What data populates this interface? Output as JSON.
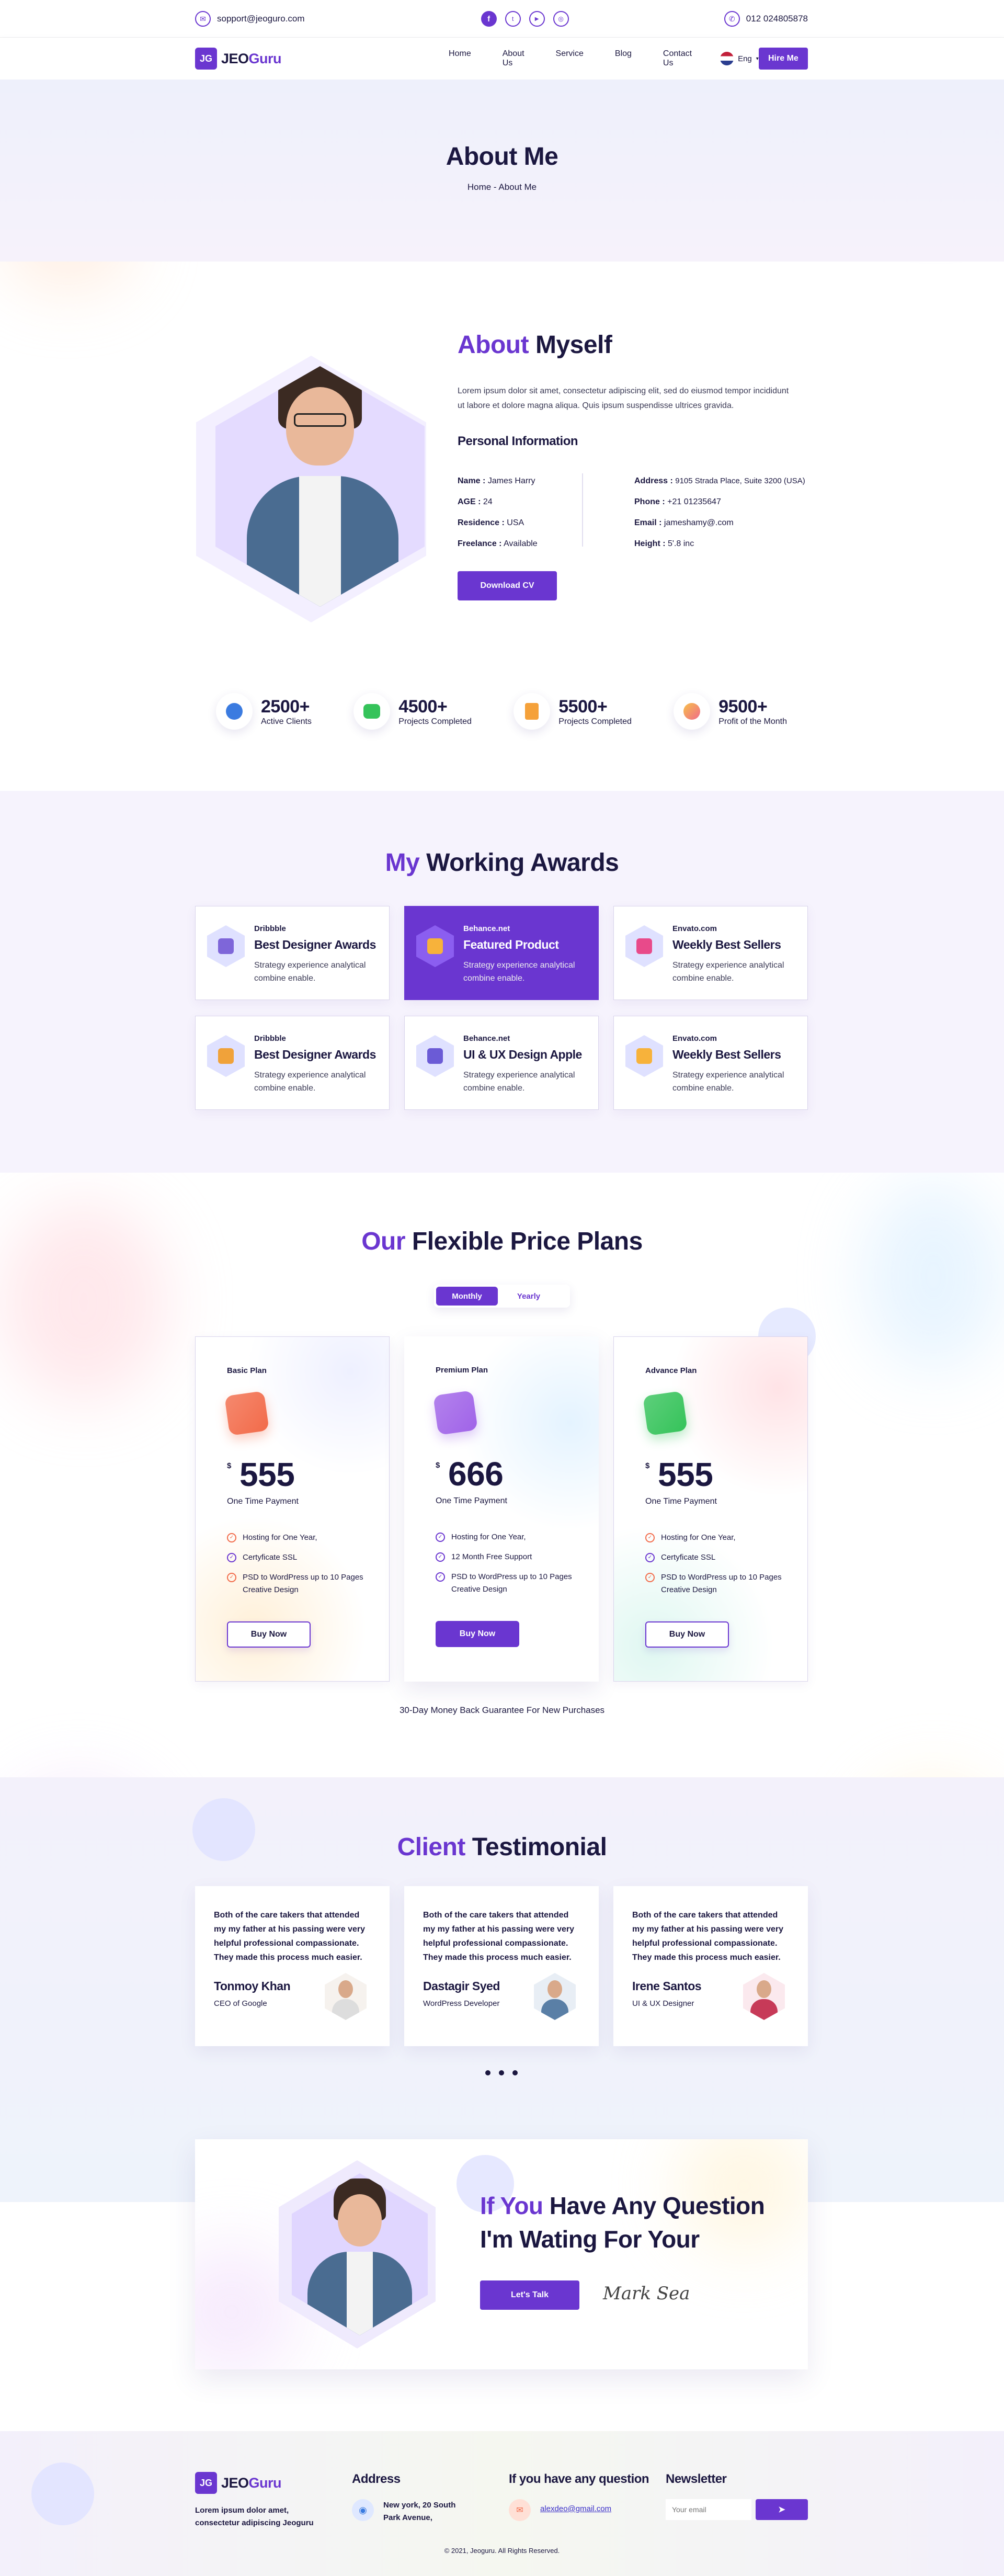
{
  "topbar": {
    "email": "sopport@jeoguro.com",
    "phone": "012 024805878",
    "socials": [
      "facebook-icon",
      "twitter-icon",
      "youtube-icon",
      "instagram-icon"
    ]
  },
  "nav": {
    "logo_mark": "JG",
    "logo_a": "JEO",
    "logo_b": "Guru",
    "links": [
      "Home",
      "About Us",
      "Service",
      "Blog",
      "Contact Us"
    ],
    "lang": "Eng",
    "hire": "Hire Me"
  },
  "hero": {
    "title": "About Me",
    "crumb": "Home - About Me"
  },
  "about": {
    "title_a": "About",
    "title_b": "Myself",
    "desc": "Lorem ipsum dolor sit amet, consectetur adipiscing elit, sed do eiusmod tempor incididunt ut labore et dolore magna aliqua. Quis ipsum suspendisse ultrices gravida.",
    "info_title": "Personal Information",
    "left": [
      {
        "k": "Name :",
        "v": "James Harry"
      },
      {
        "k": "AGE :",
        "v": "24"
      },
      {
        "k": "Residence :",
        "v": "USA"
      },
      {
        "k": "Freelance :",
        "v": "Available"
      }
    ],
    "right": [
      {
        "k": "Address :",
        "v": "9105 Strada Place, Suite 3200 (USA)"
      },
      {
        "k": "Phone :",
        "v": "+21 01235647"
      },
      {
        "k": "Email :",
        "v": "jameshamy@.com"
      },
      {
        "k": "Height :",
        "v": "5'.8 inc"
      }
    ],
    "cv": "Download CV"
  },
  "stats": [
    {
      "num": "2500+",
      "label": "Active Clients",
      "color": "#3b7be0"
    },
    {
      "num": "4500+",
      "label": "Projects Completed",
      "color": "#35c35a"
    },
    {
      "num": "5500+",
      "label": "Projects Completed",
      "color": "#f5a13a"
    },
    {
      "num": "9500+",
      "label": "Profit of the Month",
      "color": "#f06a8a"
    }
  ],
  "awards": {
    "title_a": "My",
    "title_b": "Working Awards",
    "items": [
      {
        "site": "Dribbble",
        "name": "Best Designer Awards",
        "desc": "Strategy experience analytical combine enable."
      },
      {
        "site": "Behance.net",
        "name": "Featured Product",
        "desc": "Strategy experience analytical combine enable."
      },
      {
        "site": "Envato.com",
        "name": "Weekly Best Sellers",
        "desc": "Strategy experience analytical combine enable."
      },
      {
        "site": "Dribbble",
        "name": "Best Designer Awards",
        "desc": "Strategy experience analytical combine enable."
      },
      {
        "site": "Behance.net",
        "name": "UI & UX Design Apple",
        "desc": "Strategy experience analytical combine enable."
      },
      {
        "site": "Envato.com",
        "name": "Weekly Best Sellers",
        "desc": "Strategy experience analytical combine enable."
      }
    ]
  },
  "pricing": {
    "title_a": "Our",
    "title_b": "Flexible Price Plans",
    "toggle": [
      "Monthly",
      "Yearly"
    ],
    "currency": "$",
    "guarantee": "30-Day Money Back Guarantee For New Purchases",
    "plans": [
      {
        "name": "Basic Plan",
        "price": "555",
        "period": "One Time Payment",
        "features": [
          "Hosting for One Year,",
          "Certyficate SSL",
          "PSD to WordPress up to 10 Pages Creative Design"
        ],
        "btn": "Buy Now",
        "icon": "#f26b4a"
      },
      {
        "name": "Premium Plan",
        "price": "666",
        "period": "One Time Payment",
        "features": [
          "Hosting for One Year,",
          "12 Month Free Support",
          "PSD to WordPress up to 10 Pages Creative Design"
        ],
        "btn": "Buy Now",
        "icon": "#a063e8"
      },
      {
        "name": "Advance Plan",
        "price": "555",
        "period": "One Time Payment",
        "features": [
          "Hosting for One Year,",
          "Certyficate SSL",
          "PSD to WordPress up to 10 Pages Creative Design"
        ],
        "btn": "Buy Now",
        "icon": "#35c35a"
      }
    ]
  },
  "testimonials": {
    "title_a": "Client",
    "title_b": "Testimonial",
    "items": [
      {
        "quote": "Both of the care takers that attended my my father at his passing were very helpful professional compassionate. They made this process much easier.",
        "name": "Tonmoy Khan",
        "role": "CEO of Google"
      },
      {
        "quote": "Both of the care takers that attended my my father at his passing were very helpful professional compassionate. They made this process much easier.",
        "name": "Dastagir Syed",
        "role": "WordPress Developer"
      },
      {
        "quote": "Both of the care takers that attended my my father at his passing were very helpful professional compassionate. They made this process much easier.",
        "name": "Irene Santos",
        "role": "UI & UX Designer"
      }
    ]
  },
  "cta": {
    "line1_a": "If You",
    "line1_b": "Have Any Question",
    "line2": "I'm Wating For Your",
    "btn": "Let's Talk",
    "signature": "Mark Sea"
  },
  "footer": {
    "about": "Lorem ipsum dolor amet, consectetur adipiscing Jeoguru",
    "address_title": "Address",
    "address": "New york, 20 South Park Avenue,",
    "question_title": "If you have any question",
    "email": "alexdeo@gmail.com",
    "news_title": "Newsletter",
    "news_placeholder": "Your email",
    "copyright": "© 2021, Jeoguru. All Rights Reserved."
  }
}
